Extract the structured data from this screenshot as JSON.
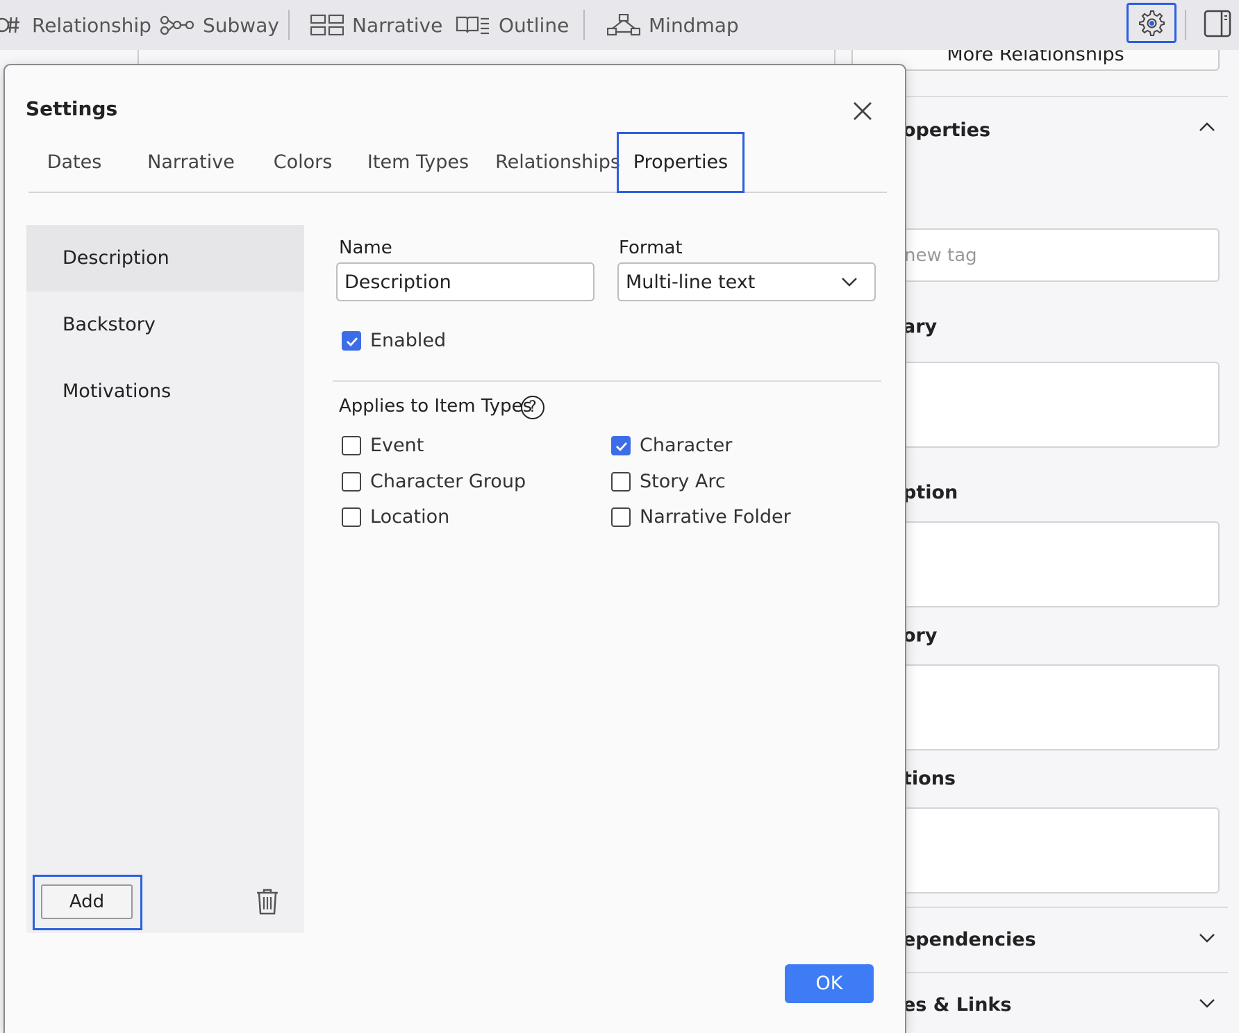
{
  "toolbar": {
    "items": [
      {
        "label": "Relationship"
      },
      {
        "label": "Subway"
      },
      {
        "label": "Narrative"
      },
      {
        "label": "Outline"
      },
      {
        "label": "Mindmap"
      }
    ]
  },
  "background_panel": {
    "more_relationships": "More Relationships",
    "properties_heading": "operties",
    "tag_placeholder": "new tag",
    "summary_label": "ary",
    "description_label": "ption",
    "backstory_label": "ory",
    "motivations_label": "tions",
    "dependencies_label": "ependencies",
    "notes_links_label": "es & Links"
  },
  "dialog": {
    "title": "Settings",
    "tabs": [
      {
        "label": "Dates"
      },
      {
        "label": "Narrative"
      },
      {
        "label": "Colors"
      },
      {
        "label": "Item Types"
      },
      {
        "label": "Relationships"
      },
      {
        "label": "Properties",
        "active": true
      }
    ],
    "properties": [
      {
        "label": "Description",
        "selected": true
      },
      {
        "label": "Backstory"
      },
      {
        "label": "Motivations"
      }
    ],
    "add_label": "Add",
    "form": {
      "name_label": "Name",
      "name_value": "Description",
      "format_label": "Format",
      "format_value": "Multi-line text",
      "enabled_label": "Enabled",
      "enabled": true,
      "applies_label": "Applies to Item Types",
      "help_glyph": "?",
      "item_types": [
        {
          "label": "Event",
          "checked": false
        },
        {
          "label": "Character",
          "checked": true
        },
        {
          "label": "Character Group",
          "checked": false
        },
        {
          "label": "Story Arc",
          "checked": false
        },
        {
          "label": "Location",
          "checked": false
        },
        {
          "label": "Narrative Folder",
          "checked": false
        }
      ]
    },
    "ok_label": "OK"
  },
  "colors": {
    "accent": "#2b5fe0",
    "checkbox": "#3d6de6",
    "ok_button": "#3d7cf5"
  }
}
